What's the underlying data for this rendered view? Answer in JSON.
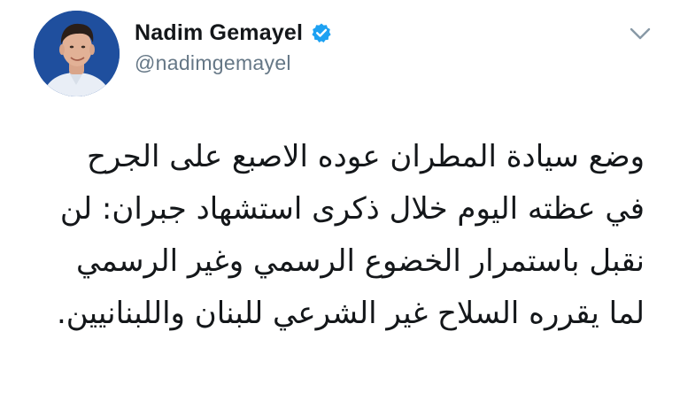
{
  "tweet": {
    "author": {
      "display_name": "Nadim Gemayel",
      "handle": "@nadimgemayel",
      "verified": true
    },
    "text_lines": [
      "وضع سيادة المطران عوده الاصبع على الجرح",
      "في عظته اليوم خلال ذكرى استشهاد جبران: لن",
      "نقبل باستمرار الخضوع الرسمي وغير الرسمي",
      "لما يقرره السلاح غير الشرعي للبنان واللبنانيين."
    ],
    "icons": {
      "verified": "verified-badge-icon",
      "menu": "chevron-down-icon"
    },
    "colors": {
      "verified_blue": "#1da1f2",
      "name_text": "#14171a",
      "handle_text": "#657786"
    }
  }
}
